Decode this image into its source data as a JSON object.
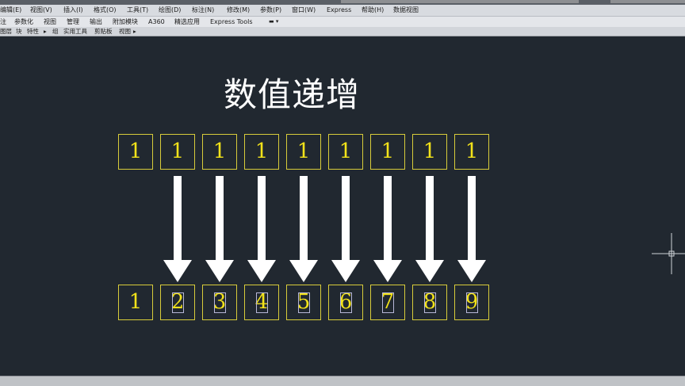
{
  "menu": [
    "编辑(E)",
    "视图(V)",
    "插入(I)",
    "格式(O)",
    "工具(T)",
    "绘图(D)",
    "标注(N)",
    "修改(M)",
    "参数(P)",
    "窗口(W)",
    "Express",
    "帮助(H)",
    "数据视图"
  ],
  "ribbon_tabs": [
    "注",
    "参数化",
    "视图",
    "管理",
    "输出",
    "附加模块",
    "A360",
    "精选应用",
    "Express Tools"
  ],
  "panels": [
    "图层",
    "块",
    "特性",
    "组",
    "实用工具",
    "剪贴板",
    "视图"
  ],
  "drawing": {
    "title": "数值递增",
    "top_row": [
      "1",
      "1",
      "1",
      "1",
      "1",
      "1",
      "1",
      "1",
      "1"
    ],
    "bottom_row": [
      "1",
      "2",
      "3",
      "4",
      "5",
      "6",
      "7",
      "8",
      "9"
    ]
  },
  "colors": {
    "background": "#212830",
    "cell_border": "#d8cc3a",
    "cell_text": "#f2e21a",
    "arrow": "#ffffff",
    "title": "#ffffff"
  }
}
